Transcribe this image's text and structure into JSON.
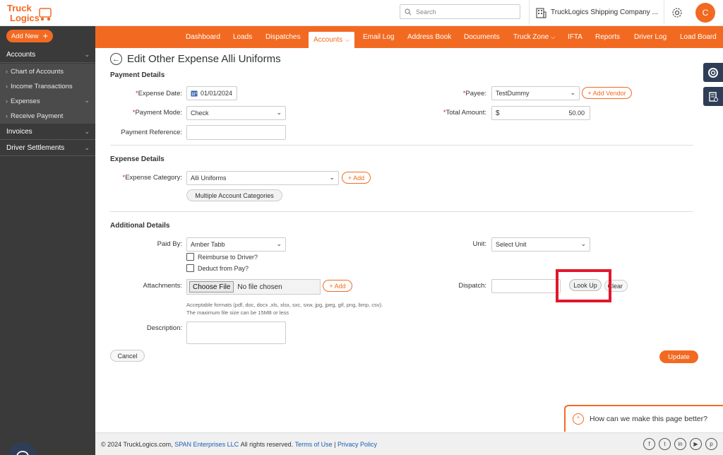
{
  "header": {
    "logo_text": "Truck Logics",
    "search_placeholder": "Search",
    "company": "TruckLogics Shipping Company ...",
    "avatar_initial": "C"
  },
  "sidebar": {
    "add_new": "Add New",
    "items": [
      {
        "label": "Accounts",
        "type": "top"
      },
      {
        "label": "Chart of Accounts",
        "type": "sub"
      },
      {
        "label": "Income Transactions",
        "type": "sub"
      },
      {
        "label": "Expenses",
        "type": "sub"
      },
      {
        "label": "Receive Payment",
        "type": "sub"
      },
      {
        "label": "Invoices",
        "type": "top"
      },
      {
        "label": "Driver Settlements",
        "type": "top"
      }
    ]
  },
  "nav": {
    "items": [
      "Dashboard",
      "Loads",
      "Dispatches",
      "Accounts",
      "Email Log",
      "Address Book",
      "Documents",
      "Truck Zone",
      "IFTA",
      "Reports",
      "Driver Log",
      "Load Board"
    ],
    "active": "Accounts"
  },
  "page": {
    "title": "Edit Other Expense Alli Uniforms",
    "payment_details": {
      "heading": "Payment Details",
      "expense_date_label": "Expense Date:",
      "expense_date": "01/01/2024",
      "payment_mode_label": "Payment Mode:",
      "payment_mode": "Check",
      "payment_reference_label": "Payment Reference:",
      "payment_reference": "",
      "payee_label": "Payee:",
      "payee": "TestDummy",
      "add_vendor": "Add Vendor",
      "total_amount_label": "Total Amount:",
      "currency": "$",
      "total_amount": "50.00"
    },
    "expense_details": {
      "heading": "Expense Details",
      "category_label": "Expense Category:",
      "category": "Alli Uniforms",
      "add": "Add",
      "multiple": "Multiple Account Categories"
    },
    "additional_details": {
      "heading": "Additional Details",
      "paid_by_label": "Paid By:",
      "paid_by": "Amber Tabb",
      "reimburse": "Reimburse to Driver?",
      "deduct": "Deduct from Pay?",
      "unit_label": "Unit:",
      "unit": "Select Unit",
      "attachments_label": "Attachments:",
      "choose_file": "Choose File",
      "no_file": "No file chosen",
      "add": "Add",
      "formats_hint": "Acceptable formats (pdf, doc, docx ,xls, xlsx, sxc, sxw, jpg, jpeg, gif, png, bmp, csv).",
      "size_hint": "The maximum file size can be 15MB or less",
      "dispatch_label": "Dispatch:",
      "look_up": "Look Up",
      "clear": "Clear",
      "description_label": "Description:"
    },
    "cancel": "Cancel",
    "update": "Update"
  },
  "feedback": "How can we make this page better?",
  "footer": {
    "copyright": "© 2024 TruckLogics.com,",
    "company_link": "SPAN Enterprises LLC",
    "rights": "All rights reserved.",
    "terms": "Terms of Use",
    "sep": "|",
    "privacy": "Privacy Policy"
  }
}
